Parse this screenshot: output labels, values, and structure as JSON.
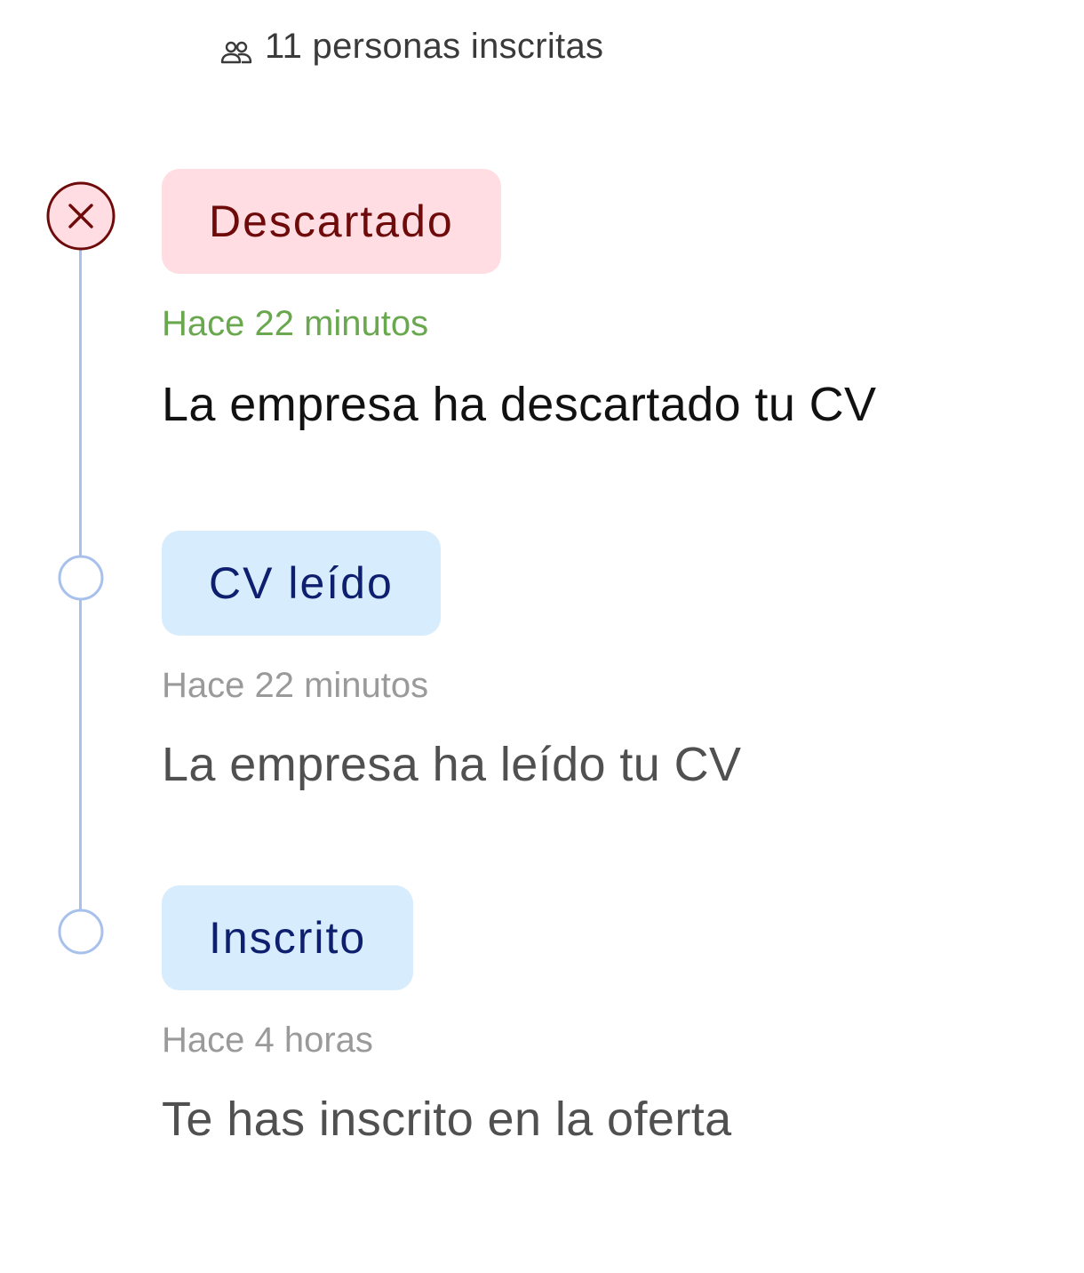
{
  "header": {
    "inscritos_icon": "people-icon",
    "inscritos_text": "11 personas inscritas"
  },
  "timeline": {
    "line_color": "#a8c1ec",
    "events": [
      {
        "icon": "close-circle-icon",
        "status": "Descartado",
        "time": "Hace 22 minutos",
        "description": "La empresa ha descartado tu CV",
        "badge_bg": "#ffdde2",
        "badge_fg": "#6e0a0a",
        "time_color": "#6aa84f"
      },
      {
        "icon": "circle-outline-icon",
        "status": "CV leído",
        "time": "Hace 22 minutos",
        "description": "La empresa ha leído tu CV",
        "badge_bg": "#d7ecfd",
        "badge_fg": "#0d1f6e",
        "time_color": "#9a9a9a"
      },
      {
        "icon": "circle-outline-icon",
        "status": "Inscrito",
        "time": "Hace 4 horas",
        "description": "Te has inscrito en la oferta",
        "badge_bg": "#d7ecfd",
        "badge_fg": "#0d1f6e",
        "time_color": "#9a9a9a"
      }
    ]
  }
}
